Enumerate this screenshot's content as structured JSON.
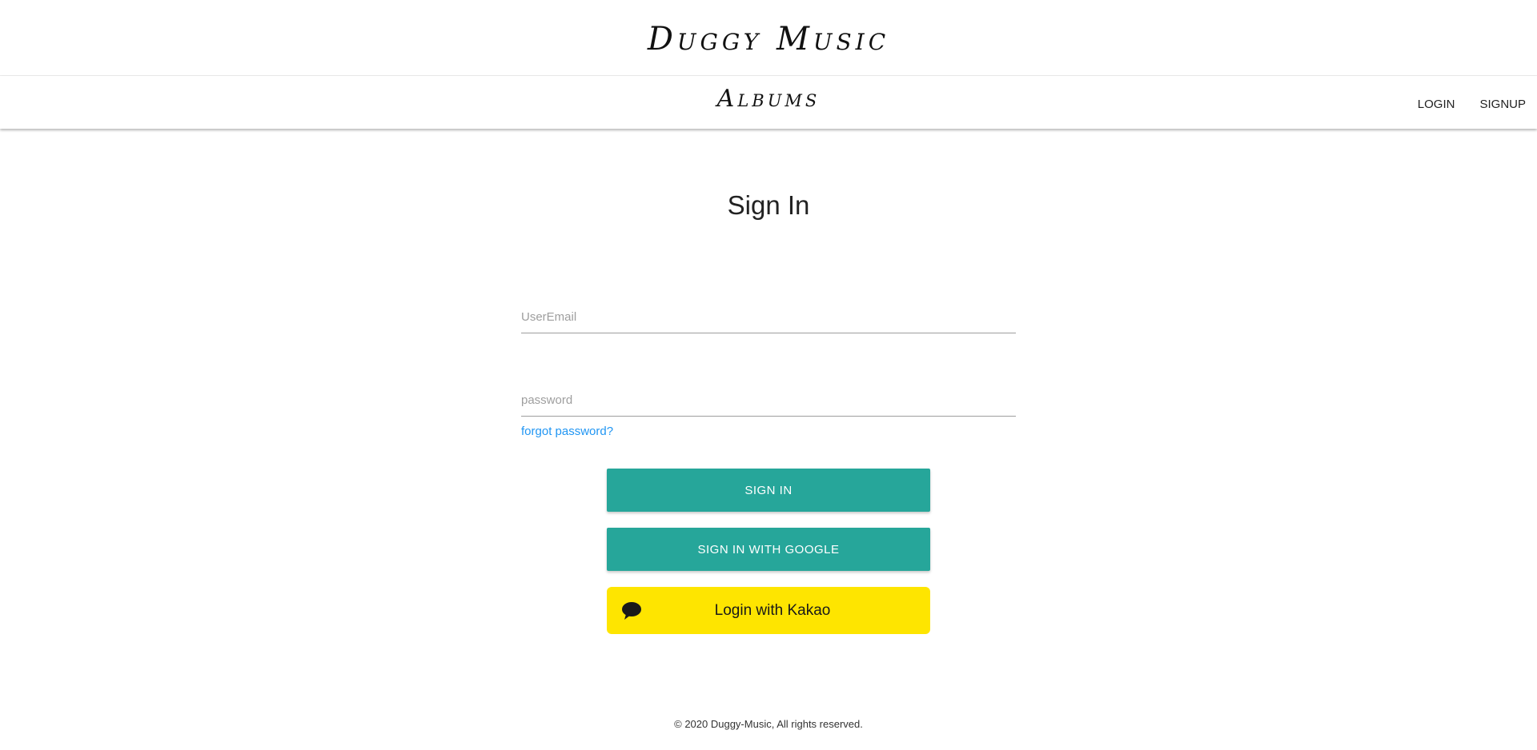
{
  "brand": {
    "title": "Duggy Music"
  },
  "nav": {
    "title": "Albums",
    "login_label": "LOGIN",
    "signup_label": "SIGNUP"
  },
  "signin": {
    "title": "Sign In",
    "email_placeholder": "UserEmail",
    "email_value": "",
    "password_placeholder": "password",
    "password_value": "",
    "forgot_label": "forgot password?",
    "signin_label": "SIGN IN",
    "google_label": "SIGN IN WITH GOOGLE",
    "kakao_label": "Login with Kakao",
    "kakao_icon": "speech-bubble-icon"
  },
  "footer": {
    "text": "© 2020 Duggy-Music, All rights reserved."
  },
  "colors": {
    "accent": "#26a69a",
    "link": "#2196f3",
    "kakao": "#fee500"
  }
}
